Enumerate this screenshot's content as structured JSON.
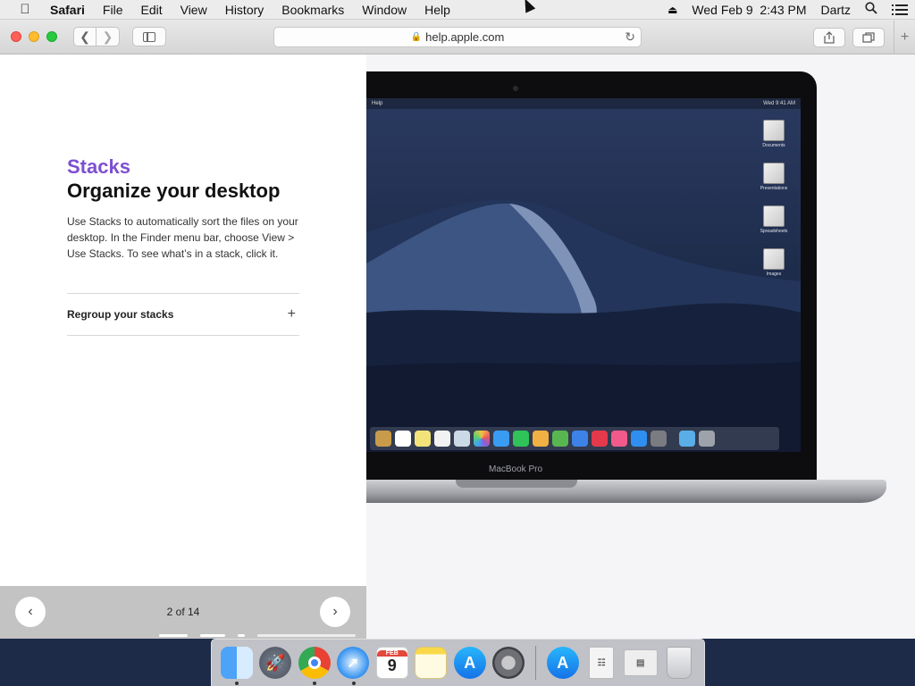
{
  "menubar": {
    "app_name": "Safari",
    "menus": [
      "File",
      "Edit",
      "View",
      "History",
      "Bookmarks",
      "Window",
      "Help"
    ],
    "datetime": "Wed Feb 9  2:43 PM",
    "user": "Dartz",
    "icons": [
      "apple-icon",
      "eject-icon",
      "search-icon",
      "notification-list-icon"
    ]
  },
  "toolbar": {
    "url": "help.apple.com",
    "icons": [
      "back-icon",
      "forward-icon",
      "sidebar-icon",
      "lock-icon",
      "reload-icon",
      "share-icon",
      "tabs-icon",
      "plus-icon"
    ]
  },
  "article": {
    "kicker": "Stacks",
    "headline": "Organize your desktop",
    "body": "Use Stacks to automatically sort the files on your desktop. In the Finder menu bar, choose View > Use Stacks. To see what’s in a stack, click it.",
    "accordion_label": "Regroup your stacks"
  },
  "pager": {
    "count": "2 of 14",
    "prev_glyph": "‹",
    "next_glyph": "›"
  },
  "illustration": {
    "menu_app": "Help",
    "menu_time": "Wed 9:41 AM",
    "stacks": [
      "Documents",
      "Presentations",
      "Spreadsheets",
      "Images"
    ],
    "label": "MacBook Pro"
  },
  "dock": {
    "calendar_month": "FEB",
    "calendar_day": "9",
    "items": [
      "finder-icon",
      "launchpad-icon",
      "chrome-icon",
      "safari-icon",
      "calendar-icon",
      "notes-icon",
      "app-store-icon",
      "system-preferences-icon",
      "app-store-icon",
      "document-icon",
      "installer-icon",
      "trash-icon"
    ]
  }
}
